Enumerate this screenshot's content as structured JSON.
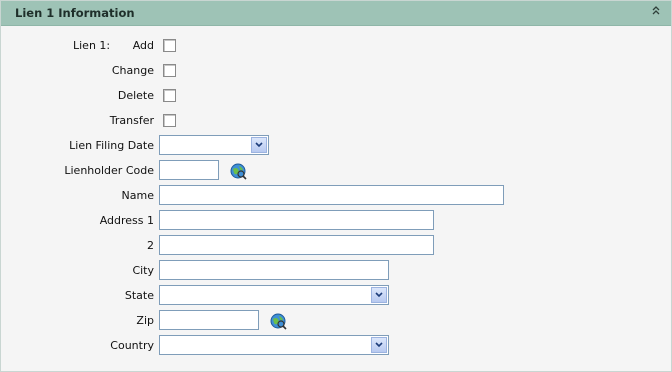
{
  "header": {
    "title": "Lien 1 Information"
  },
  "lien_label": "Lien 1:",
  "checkboxes": {
    "add": "Add",
    "change": "Change",
    "delete": "Delete",
    "transfer": "Transfer"
  },
  "fields": {
    "lien_filing_date": "Lien Filing Date",
    "lienholder_code": "Lienholder Code",
    "name": "Name",
    "address1": "Address 1",
    "address2": "2",
    "city": "City",
    "state": "State",
    "zip": "Zip",
    "country": "Country"
  },
  "values": {
    "lien_filing_date": "",
    "lienholder_code": "",
    "name": "",
    "address1": "",
    "address2": "",
    "city": "",
    "state": "",
    "zip": "",
    "country": ""
  },
  "colors": {
    "header": "#9ec3b6",
    "panel_bg": "#f5f5f5",
    "input_border": "#7f9db9"
  }
}
